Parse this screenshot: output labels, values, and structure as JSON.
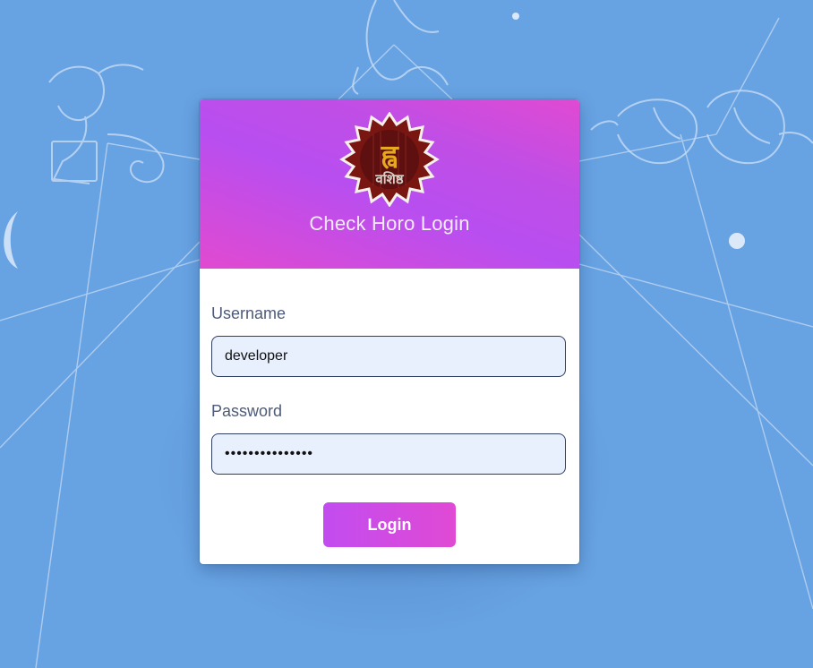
{
  "page": {
    "background_color": "#67a2e2"
  },
  "login_card": {
    "logo": {
      "icon": "zodiac-star-logo-icon",
      "text_top": "ह्व",
      "text_bottom": "वशिष्ठ"
    },
    "title": "Check Horo Login",
    "username": {
      "label": "Username",
      "value": "developer"
    },
    "password": {
      "label": "Password",
      "value": "•••••••••••••••"
    },
    "login_button_label": "Login",
    "colors": {
      "header_gradient_start": "#e14ad0",
      "header_gradient_mid": "#b84ef0",
      "button_gradient_start": "#c24cf0",
      "button_gradient_end": "#e04ad4",
      "input_background": "#e8effd"
    }
  }
}
